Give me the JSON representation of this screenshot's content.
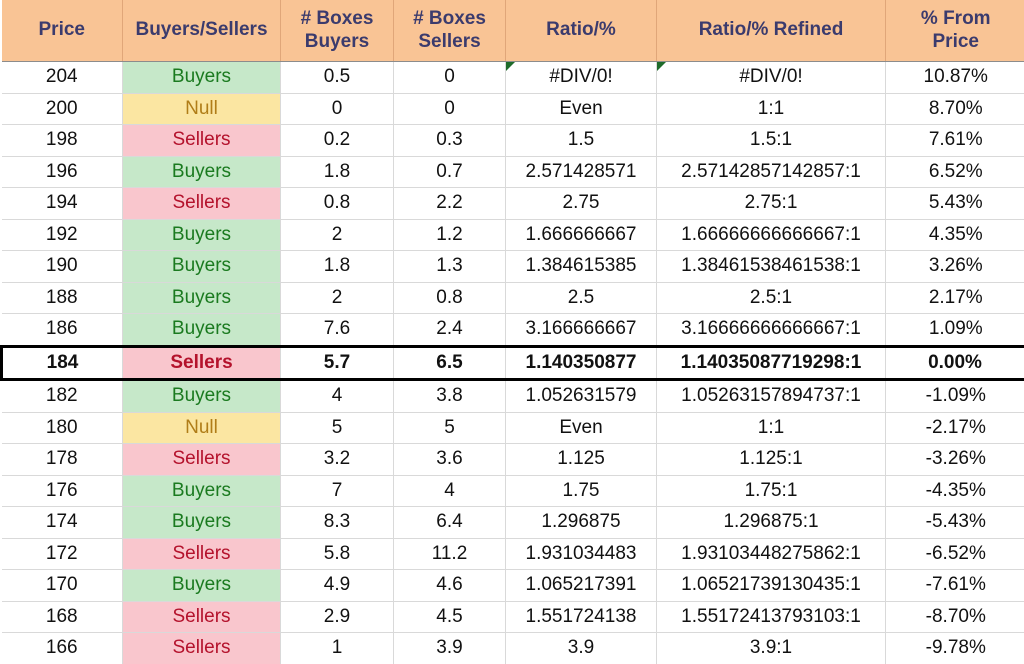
{
  "table": {
    "columns": [
      {
        "id": "price",
        "label_line1": "Price",
        "label_line2": ""
      },
      {
        "id": "sentiment",
        "label_line1": "Buyers/Sellers",
        "label_line2": ""
      },
      {
        "id": "boxes_buyers",
        "label_line1": "# Boxes",
        "label_line2": "Buyers"
      },
      {
        "id": "boxes_sellers",
        "label_line1": "# Boxes",
        "label_line2": "Sellers"
      },
      {
        "id": "ratio",
        "label_line1": "Ratio/%",
        "label_line2": ""
      },
      {
        "id": "ratio_refined",
        "label_line1": "Ratio/% Refined",
        "label_line2": ""
      },
      {
        "id": "pct_from",
        "label_line1": "% From",
        "label_line2": "Price"
      }
    ],
    "colors": {
      "header_bg": "#f9c495",
      "header_text": "#3b3b6d",
      "buyers_bg": "#c6e8c9",
      "buyers_text": "#1a7a1f",
      "sellers_bg": "#f9c6cd",
      "sellers_text": "#b4122c",
      "null_bg": "#fbe6a2",
      "null_text": "#b07d18",
      "gridline": "#d9d9d9",
      "highlight_border": "#000000",
      "error_flag": "#1e6b2a"
    },
    "rows": [
      {
        "price": "204",
        "sentiment": "Buyers",
        "sentiment_state": "buyers",
        "boxes_buyers": "0.5",
        "boxes_sellers": "0",
        "ratio": "#DIV/0!",
        "ratio_refined": "#DIV/0!",
        "pct_from": "10.87%",
        "highlight": false,
        "error_flag": true
      },
      {
        "price": "200",
        "sentiment": "Null",
        "sentiment_state": "null",
        "boxes_buyers": "0",
        "boxes_sellers": "0",
        "ratio": "Even",
        "ratio_refined": "1:1",
        "pct_from": "8.70%",
        "highlight": false,
        "error_flag": false
      },
      {
        "price": "198",
        "sentiment": "Sellers",
        "sentiment_state": "sellers",
        "boxes_buyers": "0.2",
        "boxes_sellers": "0.3",
        "ratio": "1.5",
        "ratio_refined": "1.5:1",
        "pct_from": "7.61%",
        "highlight": false,
        "error_flag": false
      },
      {
        "price": "196",
        "sentiment": "Buyers",
        "sentiment_state": "buyers",
        "boxes_buyers": "1.8",
        "boxes_sellers": "0.7",
        "ratio": "2.571428571",
        "ratio_refined": "2.57142857142857:1",
        "pct_from": "6.52%",
        "highlight": false,
        "error_flag": false
      },
      {
        "price": "194",
        "sentiment": "Sellers",
        "sentiment_state": "sellers",
        "boxes_buyers": "0.8",
        "boxes_sellers": "2.2",
        "ratio": "2.75",
        "ratio_refined": "2.75:1",
        "pct_from": "5.43%",
        "highlight": false,
        "error_flag": false
      },
      {
        "price": "192",
        "sentiment": "Buyers",
        "sentiment_state": "buyers",
        "boxes_buyers": "2",
        "boxes_sellers": "1.2",
        "ratio": "1.666666667",
        "ratio_refined": "1.66666666666667:1",
        "pct_from": "4.35%",
        "highlight": false,
        "error_flag": false
      },
      {
        "price": "190",
        "sentiment": "Buyers",
        "sentiment_state": "buyers",
        "boxes_buyers": "1.8",
        "boxes_sellers": "1.3",
        "ratio": "1.384615385",
        "ratio_refined": "1.38461538461538:1",
        "pct_from": "3.26%",
        "highlight": false,
        "error_flag": false
      },
      {
        "price": "188",
        "sentiment": "Buyers",
        "sentiment_state": "buyers",
        "boxes_buyers": "2",
        "boxes_sellers": "0.8",
        "ratio": "2.5",
        "ratio_refined": "2.5:1",
        "pct_from": "2.17%",
        "highlight": false,
        "error_flag": false
      },
      {
        "price": "186",
        "sentiment": "Buyers",
        "sentiment_state": "buyers",
        "boxes_buyers": "7.6",
        "boxes_sellers": "2.4",
        "ratio": "3.166666667",
        "ratio_refined": "3.16666666666667:1",
        "pct_from": "1.09%",
        "highlight": false,
        "error_flag": false
      },
      {
        "price": "184",
        "sentiment": "Sellers",
        "sentiment_state": "sellers",
        "boxes_buyers": "5.7",
        "boxes_sellers": "6.5",
        "ratio": "1.140350877",
        "ratio_refined": "1.14035087719298:1",
        "pct_from": "0.00%",
        "highlight": true,
        "error_flag": false
      },
      {
        "price": "182",
        "sentiment": "Buyers",
        "sentiment_state": "buyers",
        "boxes_buyers": "4",
        "boxes_sellers": "3.8",
        "ratio": "1.052631579",
        "ratio_refined": "1.05263157894737:1",
        "pct_from": "-1.09%",
        "highlight": false,
        "error_flag": false
      },
      {
        "price": "180",
        "sentiment": "Null",
        "sentiment_state": "null",
        "boxes_buyers": "5",
        "boxes_sellers": "5",
        "ratio": "Even",
        "ratio_refined": "1:1",
        "pct_from": "-2.17%",
        "highlight": false,
        "error_flag": false
      },
      {
        "price": "178",
        "sentiment": "Sellers",
        "sentiment_state": "sellers",
        "boxes_buyers": "3.2",
        "boxes_sellers": "3.6",
        "ratio": "1.125",
        "ratio_refined": "1.125:1",
        "pct_from": "-3.26%",
        "highlight": false,
        "error_flag": false
      },
      {
        "price": "176",
        "sentiment": "Buyers",
        "sentiment_state": "buyers",
        "boxes_buyers": "7",
        "boxes_sellers": "4",
        "ratio": "1.75",
        "ratio_refined": "1.75:1",
        "pct_from": "-4.35%",
        "highlight": false,
        "error_flag": false
      },
      {
        "price": "174",
        "sentiment": "Buyers",
        "sentiment_state": "buyers",
        "boxes_buyers": "8.3",
        "boxes_sellers": "6.4",
        "ratio": "1.296875",
        "ratio_refined": "1.296875:1",
        "pct_from": "-5.43%",
        "highlight": false,
        "error_flag": false
      },
      {
        "price": "172",
        "sentiment": "Sellers",
        "sentiment_state": "sellers",
        "boxes_buyers": "5.8",
        "boxes_sellers": "11.2",
        "ratio": "1.931034483",
        "ratio_refined": "1.93103448275862:1",
        "pct_from": "-6.52%",
        "highlight": false,
        "error_flag": false
      },
      {
        "price": "170",
        "sentiment": "Buyers",
        "sentiment_state": "buyers",
        "boxes_buyers": "4.9",
        "boxes_sellers": "4.6",
        "ratio": "1.065217391",
        "ratio_refined": "1.06521739130435:1",
        "pct_from": "-7.61%",
        "highlight": false,
        "error_flag": false
      },
      {
        "price": "168",
        "sentiment": "Sellers",
        "sentiment_state": "sellers",
        "boxes_buyers": "2.9",
        "boxes_sellers": "4.5",
        "ratio": "1.551724138",
        "ratio_refined": "1.55172413793103:1",
        "pct_from": "-8.70%",
        "highlight": false,
        "error_flag": false
      },
      {
        "price": "166",
        "sentiment": "Sellers",
        "sentiment_state": "sellers",
        "boxes_buyers": "1",
        "boxes_sellers": "3.9",
        "ratio": "3.9",
        "ratio_refined": "3.9:1",
        "pct_from": "-9.78%",
        "highlight": false,
        "error_flag": false
      }
    ]
  }
}
